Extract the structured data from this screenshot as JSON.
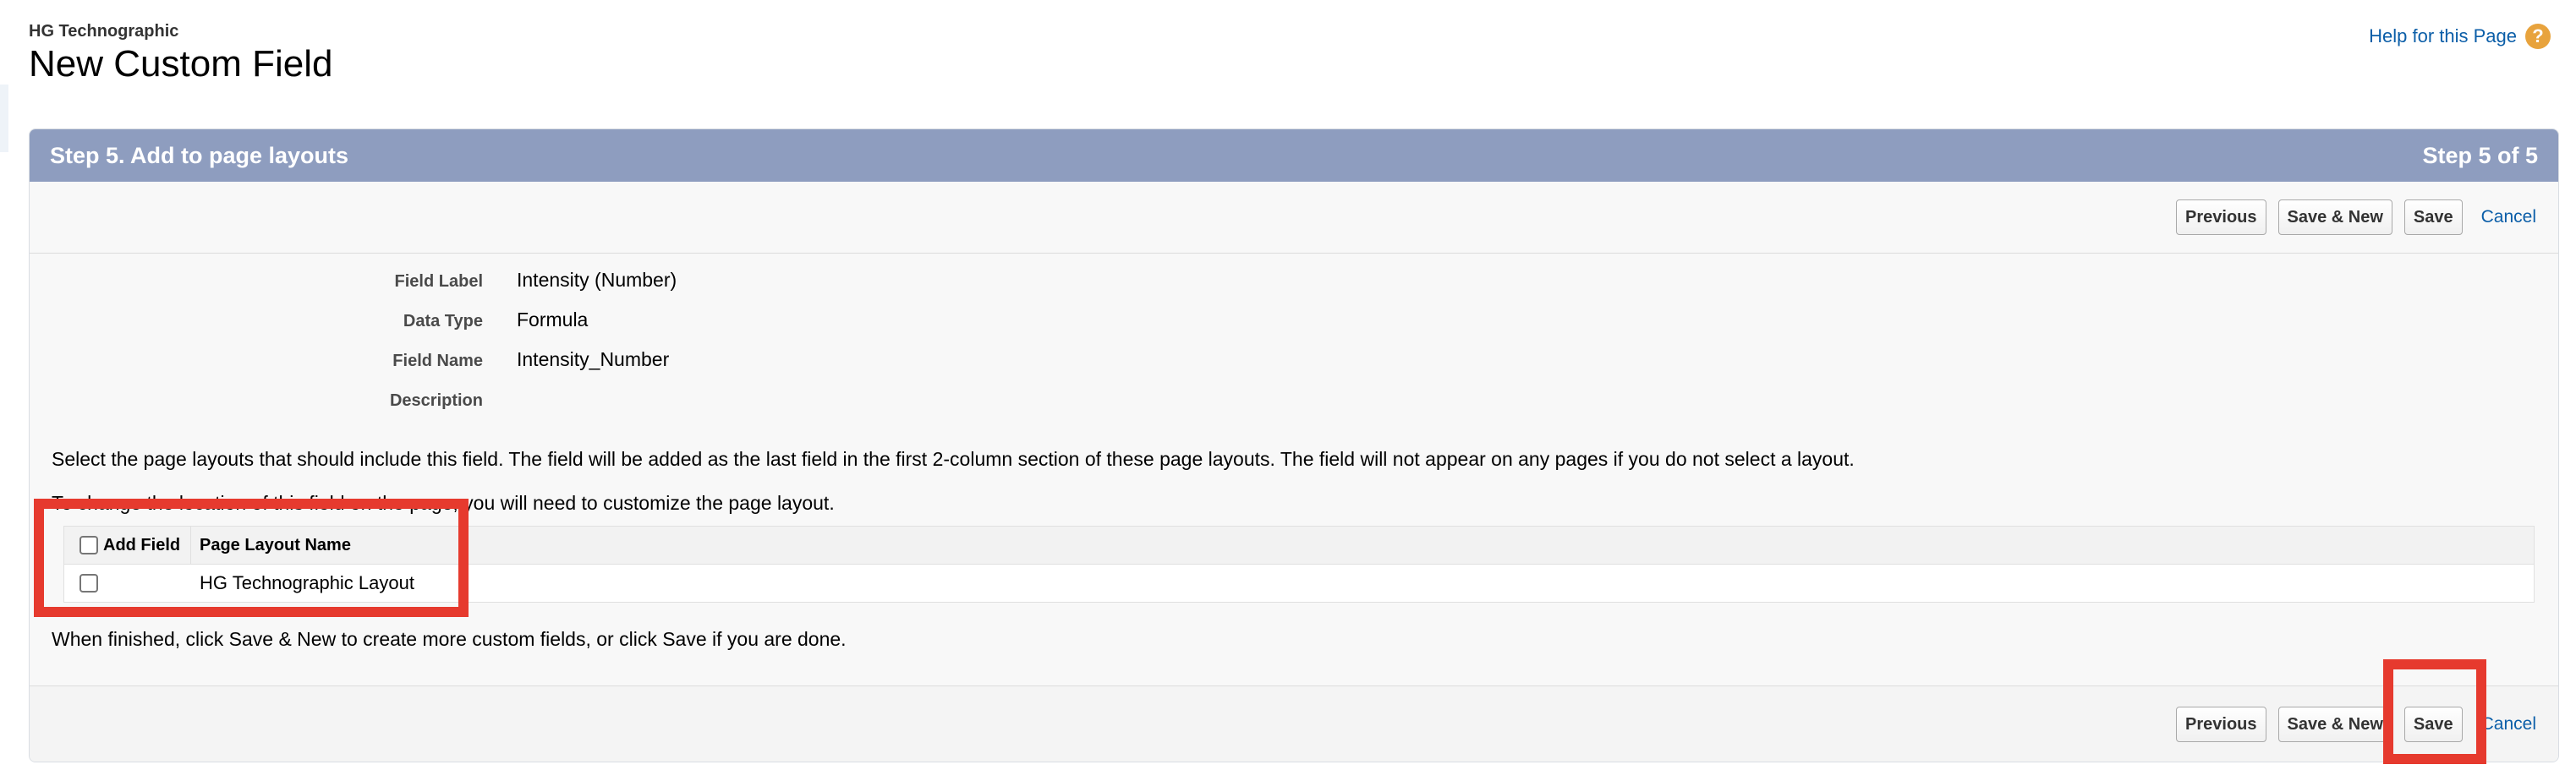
{
  "header": {
    "object_name": "HG Technographic",
    "page_title": "New Custom Field",
    "help_link": "Help for this Page",
    "help_icon": "question-icon"
  },
  "step_bar": {
    "title": "Step 5. Add to page layouts",
    "step": "Step 5 of 5"
  },
  "buttons": {
    "previous": "Previous",
    "save_new": "Save & New",
    "save": "Save",
    "cancel": "Cancel"
  },
  "field_info": [
    {
      "label": "Field Label",
      "value": "Intensity (Number)"
    },
    {
      "label": "Data Type",
      "value": "Formula"
    },
    {
      "label": "Field Name",
      "value": "Intensity_Number"
    },
    {
      "label": "Description",
      "value": ""
    }
  ],
  "instructions": {
    "line1": "Select the page layouts that should include this field. The field will be added as the last field in the first 2-column section of these page layouts. The field will not appear on any pages if you do not select a layout.",
    "line2": "To change the location of this field on the page, you will need to customize the page layout.",
    "line3": "When finished, click Save & New to create more custom fields, or click Save if you are done."
  },
  "layout_table": {
    "headers": [
      "Add Field",
      "Page Layout Name"
    ],
    "rows": [
      {
        "checked": false,
        "name": "HG Technographic Layout"
      }
    ]
  },
  "colors": {
    "step_bar": "#8e9dbf",
    "link": "#0b5ea8",
    "highlight": "#e63a2e",
    "help_icon": "#e8a33d"
  }
}
